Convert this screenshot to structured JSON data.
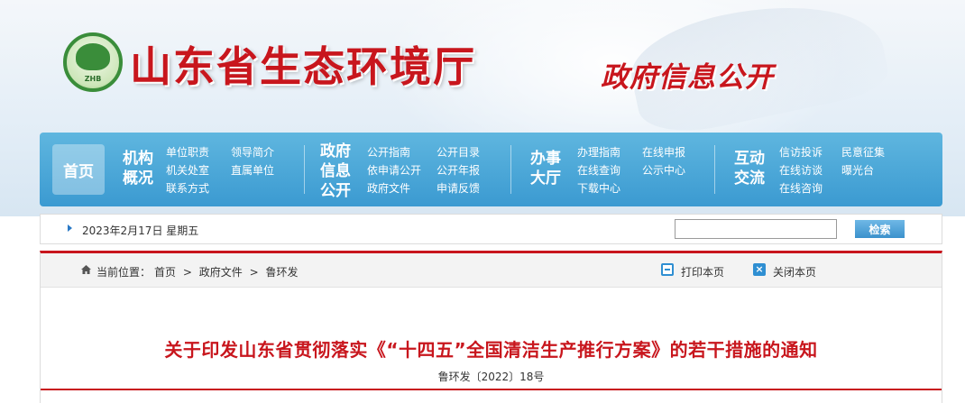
{
  "site": {
    "title": "山东省生态环境厅",
    "subtitle": "政府信息公开",
    "logo_text": "ZHB"
  },
  "nav": {
    "home": "首页",
    "groups": [
      {
        "category_lines": [
          "机构",
          "概况"
        ],
        "links": [
          "单位职责",
          "领导简介",
          "机关处室",
          "直属单位",
          "联系方式"
        ]
      },
      {
        "category_lines": [
          "政府",
          "信息",
          "公开"
        ],
        "links": [
          "公开指南",
          "公开目录",
          "依申请公开",
          "公开年报",
          "政府文件",
          "申请反馈"
        ]
      },
      {
        "category_lines": [
          "办事",
          "大厅"
        ],
        "links": [
          "办理指南",
          "在线申报",
          "在线查询",
          "公示中心",
          "下载中心"
        ]
      },
      {
        "category_lines": [
          "互动",
          "交流"
        ],
        "links": [
          "信访投诉",
          "民意征集",
          "在线访谈",
          "曝光台",
          "在线咨询"
        ]
      }
    ]
  },
  "datebar": {
    "date": "2023年2月17日 星期五",
    "search_value": "",
    "search_button": "检索"
  },
  "breadcrumb": {
    "prefix": "当前位置：",
    "items": [
      "首页",
      "政府文件",
      "鲁环发"
    ],
    "separator": ">"
  },
  "actions": {
    "print": "打印本页",
    "close": "关闭本页"
  },
  "document": {
    "title": "关于印发山东省贯彻落实《“十四五”全国清洁生产推行方案》的若干措施的通知",
    "number": "鲁环发〔2022〕18号"
  },
  "colors": {
    "brand_red": "#c8161d",
    "nav_blue": "#3b9ad1",
    "logo_green": "#3a8d3a"
  }
}
